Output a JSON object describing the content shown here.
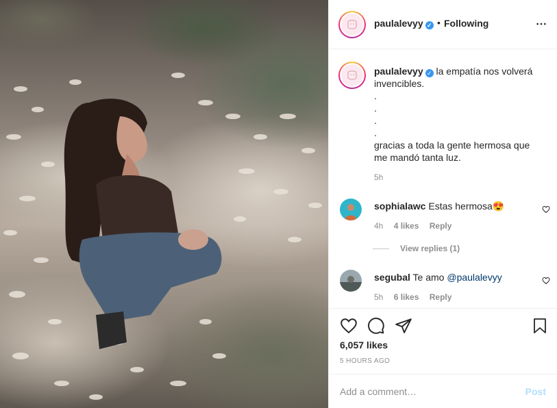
{
  "post": {
    "username": "paulalevyy",
    "verified_mark": "✓",
    "separator": "•",
    "follow_status": "Following",
    "more_icon": "⋯",
    "caption_lines": [
      "la empatía nos volverá invencibles.",
      ".",
      ".",
      ".",
      ".",
      "gracias a toda la gente hermosa que me mandó tanta luz."
    ],
    "caption_time": "5h"
  },
  "comments": [
    {
      "username": "sophialawc",
      "text": "Estas hermosa",
      "emoji": "😍",
      "time": "4h",
      "likes": "4 likes",
      "reply": "Reply"
    },
    {
      "username": "segubal",
      "text": "Te amo ",
      "mention": "@paulalevyy",
      "time": "5h",
      "likes": "6 likes",
      "reply": "Reply"
    }
  ],
  "view_replies": "View replies (1)",
  "actions": {
    "like_icon": "heart-icon",
    "comment_icon": "comment-icon",
    "share_icon": "paper-plane-icon",
    "save_icon": "bookmark-icon"
  },
  "likes": "6,057 likes",
  "posted": "5 HOURS AGO",
  "comment_box": {
    "placeholder": "Add a comment…",
    "post_label": "Post"
  },
  "colors": {
    "link": "#00376b",
    "verified": "#3897f0",
    "post_disabled": "#b2dffc",
    "muted": "#8e8e8e"
  }
}
